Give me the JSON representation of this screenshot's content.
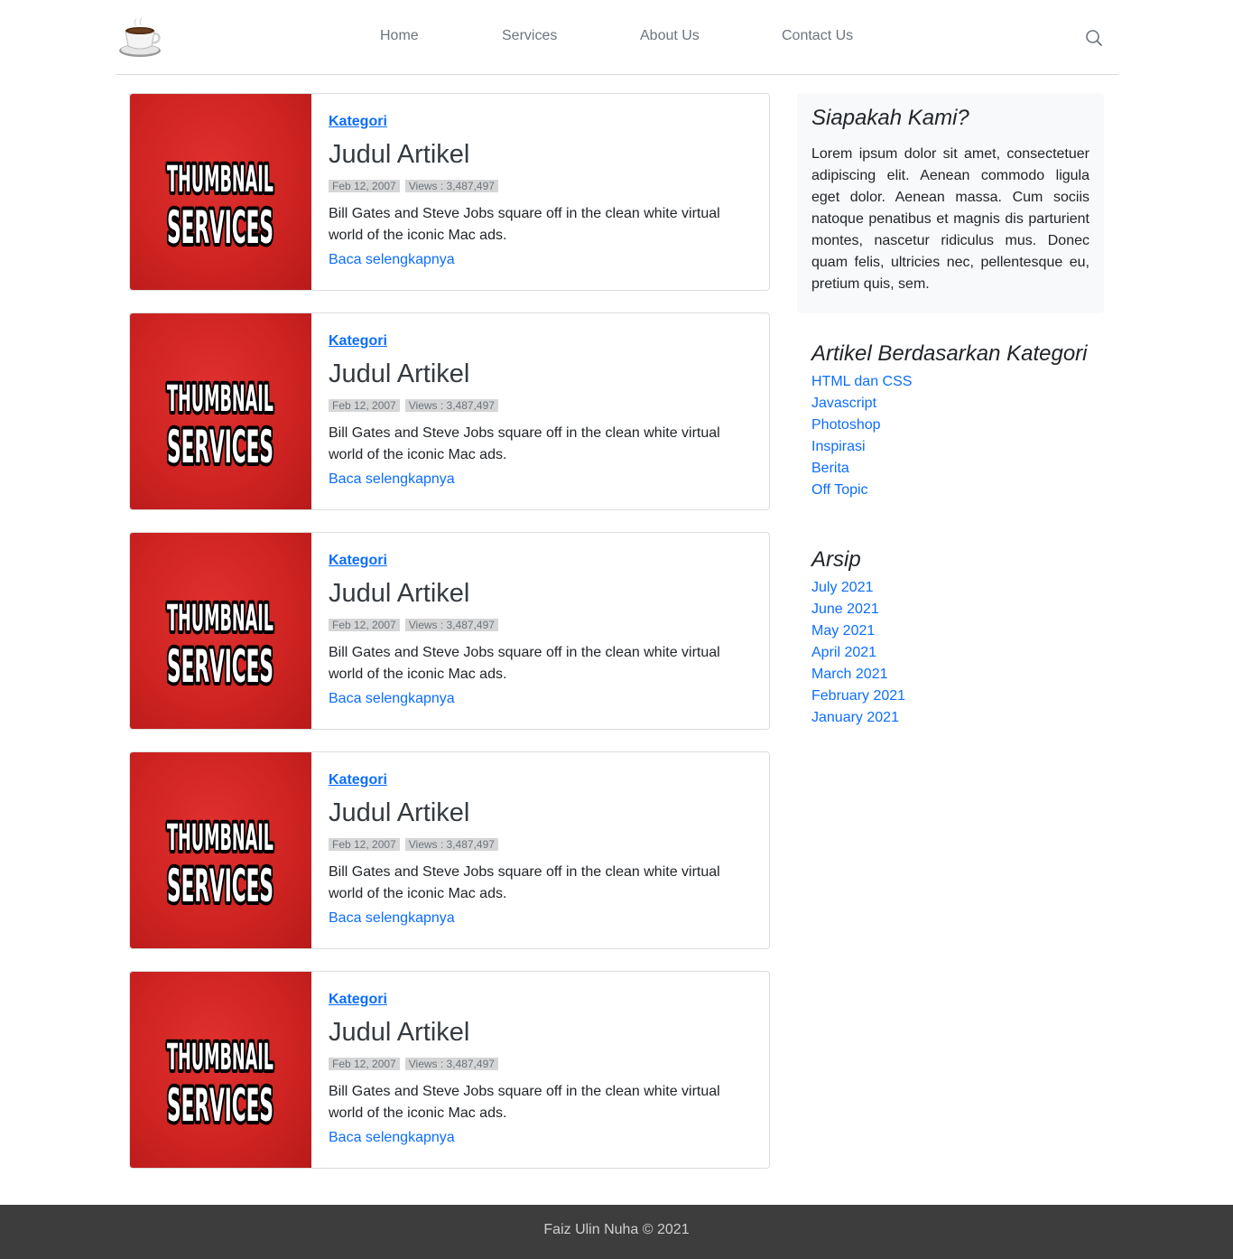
{
  "nav": {
    "items": [
      {
        "label": "Home"
      },
      {
        "label": "Services"
      },
      {
        "label": "About Us"
      },
      {
        "label": "Contact Us"
      }
    ]
  },
  "colors": {
    "accent": "#0d6efd",
    "thumbnail_red": "#d42826",
    "footer_bg": "#3d3d3d"
  },
  "thumbnail": {
    "line1": "THUMBNAIL",
    "line2": "SERVICES"
  },
  "posts": [
    {
      "category": "Kategori",
      "title": "Judul Artikel",
      "date": "Feb 12, 2007",
      "views": "Views : 3,487,497",
      "excerpt": "Bill Gates and Steve Jobs square off in the clean white virtual world of the iconic Mac ads.",
      "more": "Baca selengkapnya"
    },
    {
      "category": "Kategori",
      "title": "Judul Artikel",
      "date": "Feb 12, 2007",
      "views": "Views : 3,487,497",
      "excerpt": "Bill Gates and Steve Jobs square off in the clean white virtual world of the iconic Mac ads.",
      "more": "Baca selengkapnya"
    },
    {
      "category": "Kategori",
      "title": "Judul Artikel",
      "date": "Feb 12, 2007",
      "views": "Views : 3,487,497",
      "excerpt": "Bill Gates and Steve Jobs square off in the clean white virtual world of the iconic Mac ads.",
      "more": "Baca selengkapnya"
    },
    {
      "category": "Kategori",
      "title": "Judul Artikel",
      "date": "Feb 12, 2007",
      "views": "Views : 3,487,497",
      "excerpt": "Bill Gates and Steve Jobs square off in the clean white virtual world of the iconic Mac ads.",
      "more": "Baca selengkapnya"
    },
    {
      "category": "Kategori",
      "title": "Judul Artikel",
      "date": "Feb 12, 2007",
      "views": "Views : 3,487,497",
      "excerpt": "Bill Gates and Steve Jobs square off in the clean white virtual world of the iconic Mac ads.",
      "more": "Baca selengkapnya"
    }
  ],
  "sidebar": {
    "about": {
      "title": "Siapakah Kami?",
      "text": "Lorem ipsum dolor sit amet, consectetuer adipiscing elit. Aenean commodo ligula eget dolor. Aenean massa. Cum sociis natoque penatibus et magnis dis parturient montes, nascetur ridiculus mus. Donec quam felis, ultricies nec, pellentesque eu, pretium quis, sem."
    },
    "categories": {
      "title": "Artikel Berdasarkan Kategori",
      "items": [
        "HTML dan CSS",
        "Javascript",
        "Photoshop",
        "Inspirasi",
        "Berita",
        "Off Topic"
      ]
    },
    "archive": {
      "title": "Arsip",
      "items": [
        "July 2021",
        "June 2021",
        "May 2021",
        "April 2021",
        "March 2021",
        "February 2021",
        "January 2021"
      ]
    }
  },
  "footer": {
    "text": "Faiz Ulin Nuha © 2021"
  }
}
